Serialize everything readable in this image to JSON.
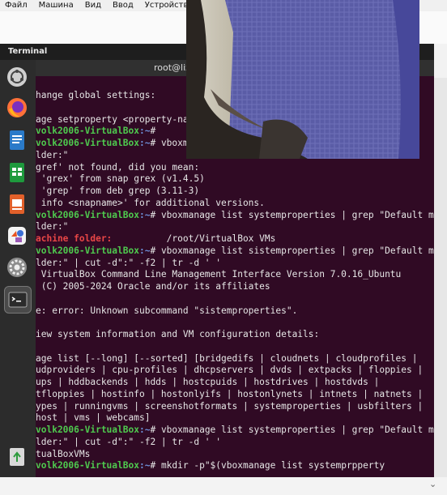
{
  "host_menu": [
    "Файл",
    "Машина",
    "Вид",
    "Ввод",
    "Устройства"
  ],
  "topbar": {
    "title": "Terminal"
  },
  "terminal": {
    "header_title": "root@liz",
    "lines": [
      {
        "segs": [
          {
            "t": "hange global settings:",
            "c": ""
          }
        ]
      },
      {
        "segs": [
          {
            "t": "",
            "c": ""
          }
        ]
      },
      {
        "segs": [
          {
            "t": "age setproperty <property-na",
            "c": ""
          }
        ]
      },
      {
        "segs": [
          {
            "t": "volk2006-VirtualBox",
            "c": "g"
          },
          {
            "t": ":~",
            "c": "b"
          },
          {
            "t": "# ",
            "c": ""
          }
        ]
      },
      {
        "segs": [
          {
            "t": "volk2006-VirtualBox",
            "c": "g"
          },
          {
            "t": ":~",
            "c": "b"
          },
          {
            "t": "# vboxm",
            "c": ""
          }
        ]
      },
      {
        "segs": [
          {
            "t": "lder:\"",
            "c": ""
          }
        ]
      },
      {
        "segs": [
          {
            "t": "gref' not found, did you mean:",
            "c": ""
          }
        ]
      },
      {
        "segs": [
          {
            "t": " 'grex' from snap grex (v1.4.5)",
            "c": ""
          }
        ]
      },
      {
        "segs": [
          {
            "t": " 'grep' from deb grep (3.11-3)",
            "c": ""
          }
        ]
      },
      {
        "segs": [
          {
            "t": " info <snapname>' for additional versions.",
            "c": ""
          }
        ]
      },
      {
        "segs": [
          {
            "t": "volk2006-VirtualBox",
            "c": "g"
          },
          {
            "t": ":~",
            "c": "b"
          },
          {
            "t": "# vboxmanage list systemproperties | grep \"Default ma",
            "c": ""
          }
        ]
      },
      {
        "segs": [
          {
            "t": "lder:\"",
            "c": ""
          }
        ]
      },
      {
        "segs": [
          {
            "t": "achine folder:",
            "c": "r"
          },
          {
            "t": "          /root/VirtualBox VMs",
            "c": ""
          }
        ]
      },
      {
        "segs": [
          {
            "t": "volk2006-VirtualBox",
            "c": "g"
          },
          {
            "t": ":~",
            "c": "b"
          },
          {
            "t": "# vboxmanage list sistemproperties | grep \"Default ma",
            "c": ""
          }
        ]
      },
      {
        "segs": [
          {
            "t": "lder:\" | cut -d\":\" -f2 | tr -d ' '",
            "c": ""
          }
        ]
      },
      {
        "segs": [
          {
            "t": " VirtualBox Command Line Management Interface Version 7.0.16_Ubuntu",
            "c": ""
          }
        ]
      },
      {
        "segs": [
          {
            "t": " (C) 2005-2024 Oracle and/or its affiliates",
            "c": ""
          }
        ]
      },
      {
        "segs": [
          {
            "t": "",
            "c": ""
          }
        ]
      },
      {
        "segs": [
          {
            "t": "e: error: Unknown subcommand \"sistemproperties\".",
            "c": ""
          }
        ]
      },
      {
        "segs": [
          {
            "t": "",
            "c": ""
          }
        ]
      },
      {
        "segs": [
          {
            "t": "iew system information and VM configuration details:",
            "c": ""
          }
        ]
      },
      {
        "segs": [
          {
            "t": "",
            "c": ""
          }
        ]
      },
      {
        "segs": [
          {
            "t": "age list [--long] [--sorted] [bridgedifs | cloudnets | cloudprofiles |",
            "c": ""
          }
        ]
      },
      {
        "segs": [
          {
            "t": "udproviders | cpu-profiles | dhcpservers | dvds | extpacks | floppies |",
            "c": ""
          }
        ]
      },
      {
        "segs": [
          {
            "t": "ups | hddbackends | hdds | hostcpuids | hostdrives | hostdvds |",
            "c": ""
          }
        ]
      },
      {
        "segs": [
          {
            "t": "tfloppies | hostinfo | hostonlyifs | hostonlynets | intnets | natnets |",
            "c": ""
          }
        ]
      },
      {
        "segs": [
          {
            "t": "ypes | runningvms | screenshotformats | systemproperties | usbfilters |",
            "c": ""
          }
        ]
      },
      {
        "segs": [
          {
            "t": "host | vms | webcams]",
            "c": ""
          }
        ]
      },
      {
        "segs": [
          {
            "t": "volk2006-VirtualBox",
            "c": "g"
          },
          {
            "t": ":~",
            "c": "b"
          },
          {
            "t": "# vboxmanage list systemproperties | grep \"Default ma",
            "c": ""
          }
        ]
      },
      {
        "segs": [
          {
            "t": "lder:\" | cut -d\":\" -f2 | tr -d ' '",
            "c": ""
          }
        ]
      },
      {
        "segs": [
          {
            "t": "tualBoxVMs",
            "c": ""
          }
        ]
      },
      {
        "segs": [
          {
            "t": "volk2006-VirtualBox",
            "c": "g"
          },
          {
            "t": ":~",
            "c": "b"
          },
          {
            "t": "# mkdir -p\"$(vboxmanage list systemprpperty",
            "c": ""
          }
        ]
      }
    ]
  },
  "dock": [
    {
      "name": "ubuntu-software-icon",
      "active": false
    },
    {
      "name": "firefox-icon",
      "active": false
    },
    {
      "name": "writer-icon",
      "active": false
    },
    {
      "name": "calc-icon",
      "active": false
    },
    {
      "name": "impress-icon",
      "active": false
    },
    {
      "name": "app-center-icon",
      "active": false
    },
    {
      "name": "settings-icon",
      "active": false
    },
    {
      "name": "terminal-icon",
      "active": true
    },
    {
      "name": "trash-icon",
      "active": false
    }
  ],
  "colors": {
    "terminal_bg": "#300a24",
    "prompt_user": "#4ec94e",
    "prompt_path": "#6d8fd8",
    "grep_match": "#e84646"
  }
}
